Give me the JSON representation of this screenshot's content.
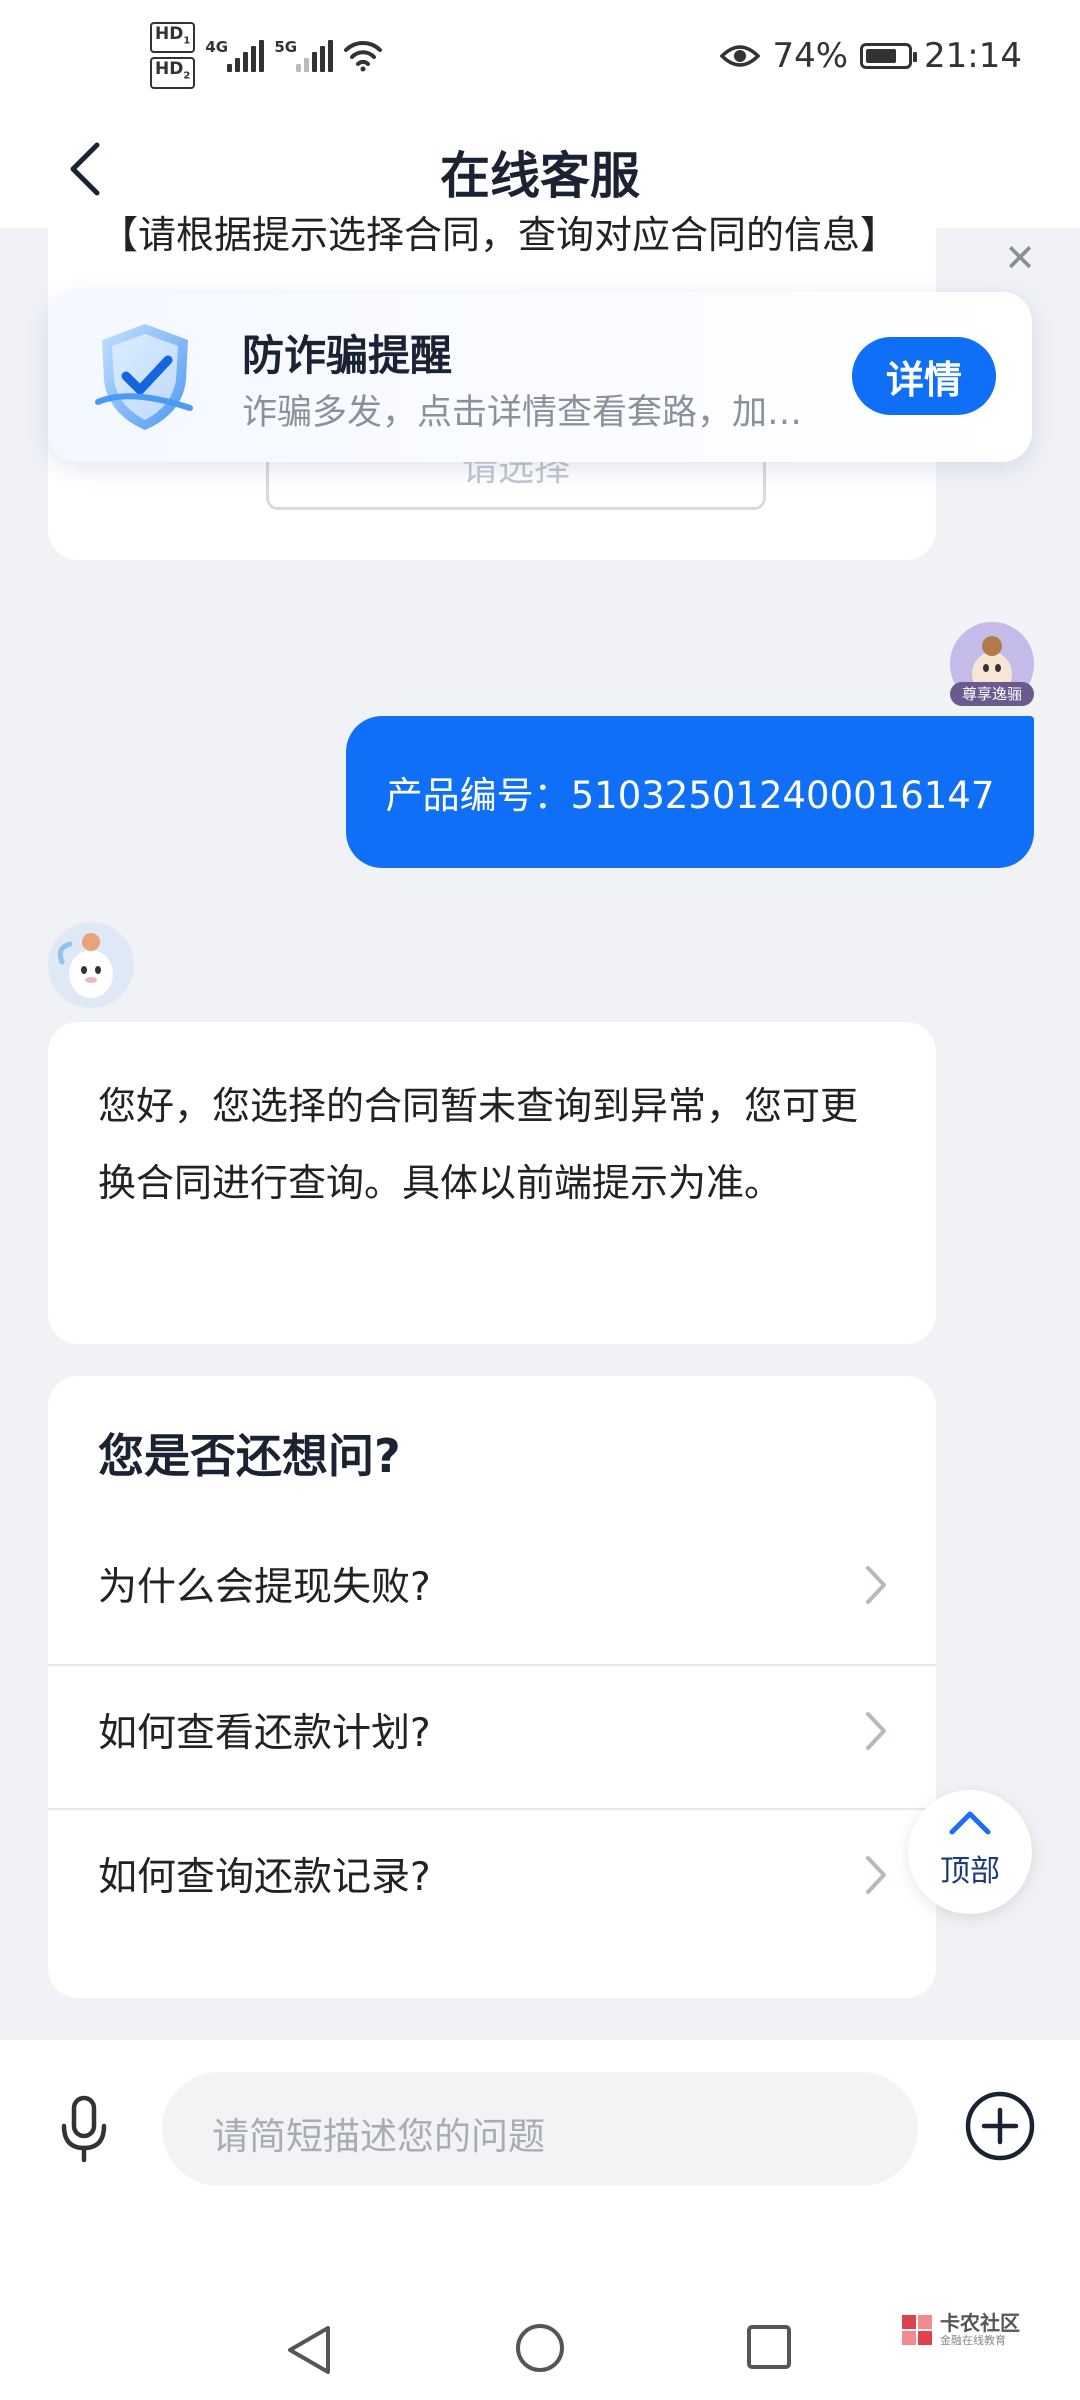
{
  "status_bar": {
    "hd1": "HD",
    "hd1_sub": "1",
    "hd2": "HD",
    "hd2_sub": "2",
    "net1": "4G",
    "net2": "5G",
    "battery_percent": "74%",
    "battery_level": 0.74,
    "time": "21:14"
  },
  "header": {
    "title": "在线客服"
  },
  "top_card": {
    "partial_text": "【请根据提示选择合同，查询对应合同的信息】",
    "select_placeholder": "请选择"
  },
  "fraud_banner": {
    "title": "防诈骗提醒",
    "description": "诈骗多发，点击详情查看套路，加强防范意识",
    "detail_label": "详情"
  },
  "user_message": {
    "avatar_tag": "尊享逸骊",
    "text": "产品编号：510325012400016147"
  },
  "bot_message": {
    "text": "您好，您选择的合同暂未查询到异常，您可更换合同进行查询。具体以前端提示为准。"
  },
  "faq": {
    "title": "您是否还想问?",
    "items": [
      {
        "label": "为什么会提现失败?"
      },
      {
        "label": "如何查看还款计划?"
      },
      {
        "label": "如何查询还款记录?"
      }
    ]
  },
  "scroll_top": {
    "label": "顶部"
  },
  "input_bar": {
    "placeholder": "请简短描述您的问题"
  },
  "watermark": {
    "main": "卡农社区",
    "sub": "金融在线教育"
  },
  "colors": {
    "primary": "#0f6ff7",
    "background": "#f0f2f6"
  }
}
